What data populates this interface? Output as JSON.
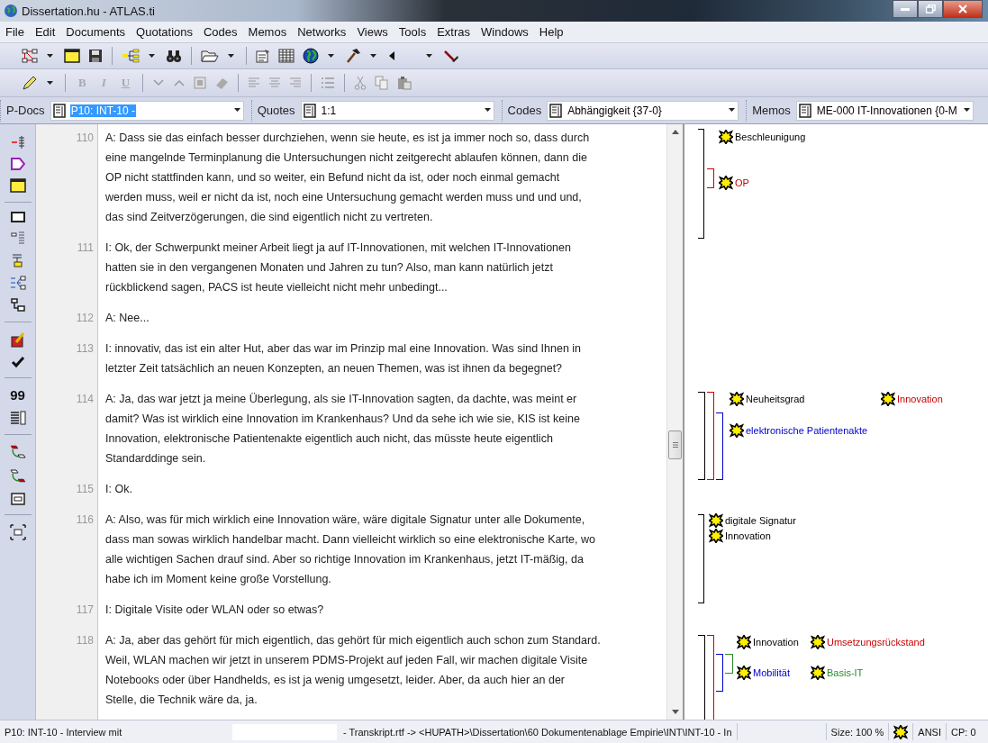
{
  "window": {
    "title": "Dissertation.hu - ATLAS.ti"
  },
  "menu": [
    "File",
    "Edit",
    "Documents",
    "Quotations",
    "Codes",
    "Memos",
    "Networks",
    "Views",
    "Tools",
    "Extras",
    "Windows",
    "Help"
  ],
  "format_buttons": [
    {
      "label": "B",
      "kind": "bold",
      "disabled": true
    },
    {
      "label": "I",
      "kind": "italic",
      "disabled": true
    },
    {
      "label": "U",
      "kind": "underline",
      "disabled": true
    }
  ],
  "side_toolbar": {
    "count_label": "99"
  },
  "selectors": [
    {
      "label": "P-Docs",
      "value": "P10: INT-10 -",
      "focused": true
    },
    {
      "label": "Quotes",
      "value": "1:1",
      "focused": false
    },
    {
      "label": "Codes",
      "value": "Abhängigkeit {37-0}",
      "focused": false
    },
    {
      "label": "Memos",
      "value": "ME-000 IT-Innovationen {0-M",
      "focused": false
    }
  ],
  "paragraphs": [
    {
      "number": "110",
      "lines": [
        "A: Dass sie das einfach besser durchziehen, wenn sie heute, es ist ja immer noch so, dass durch",
        "eine mangelnde Terminplanung die Untersuchungen nicht zeitgerecht ablaufen können, dann die",
        "OP nicht stattfinden kann, und so weiter, ein Befund nicht da ist, oder noch einmal gemacht",
        "werden muss, weil er nicht da ist, noch eine Untersuchung gemacht werden muss und und und,",
        "das sind Zeitverzögerungen, die sind eigentlich nicht zu vertreten."
      ]
    },
    {
      "number": "111",
      "lines": [
        "I: Ok, der Schwerpunkt meiner Arbeit liegt ja auf IT-Innovationen, mit welchen IT-Innovationen",
        "hatten sie in den vergangenen Monaten und Jahren zu tun? Also, man kann natürlich jetzt",
        "rückblickend sagen, PACS ist heute vielleicht nicht mehr unbedingt..."
      ]
    },
    {
      "number": "112",
      "lines": [
        "A: Nee..."
      ]
    },
    {
      "number": "113",
      "lines": [
        "I: innovativ, das ist ein alter Hut, aber das war im Prinzip mal eine Innovation. Was sind Ihnen in",
        "letzter Zeit tatsächlich an neuen Konzepten, an neuen Themen, was ist ihnen da begegnet?"
      ]
    },
    {
      "number": "114",
      "lines": [
        "A: Ja, das war jetzt ja meine Überlegung, als sie IT-Innovation sagten, da dachte, was meint er",
        "damit? Was ist wirklich eine Innovation im Krankenhaus? Und da sehe ich wie sie, KIS ist keine",
        "Innovation, elektronische Patientenakte eigentlich auch nicht, das müsste heute eigentlich",
        "Standarddinge sein."
      ]
    },
    {
      "number": "115",
      "lines": [
        "I: Ok."
      ]
    },
    {
      "number": "116",
      "lines": [
        "A: Also, was für mich wirklich eine Innovation wäre, wäre digitale Signatur unter alle Dokumente,",
        "dass man sowas wirklich handelbar macht. Dann vielleicht wirklich so eine elektronische Karte, wo",
        "alle wichtigen Sachen drauf sind. Aber so richtige Innovation im Krankenhaus, jetzt IT-mäßig, da",
        "habe ich im Moment keine große Vorstellung."
      ]
    },
    {
      "number": "117",
      "lines": [
        "I: Digitale Visite oder WLAN oder so etwas?"
      ]
    },
    {
      "number": "118",
      "lines": [
        "A: Ja, aber das gehört für mich eigentlich, das gehört für mich eigentlich auch schon zum Standard.",
        "Weil, WLAN machen wir jetzt in unserem PDMS-Projekt auf jeden Fall, wir machen digitale Visite",
        "Notebooks oder über Handhelds, es ist ja wenig umgesetzt, leider. Aber, da auch hier an der",
        "Stelle, die Technik wäre da, ja."
      ]
    }
  ],
  "margin": [
    {
      "brackets": [
        {
          "color": "#000000",
          "codes": [
            "Beschleunigung"
          ]
        },
        {
          "color": "#cc0000",
          "codes": [
            "OP"
          ]
        }
      ]
    },
    {
      "brackets": [
        {
          "color": "#000000",
          "codes": [
            "Neuheitsgrad"
          ]
        },
        {
          "color": "#cc0000",
          "codes": [
            "Innovation"
          ]
        },
        {
          "color": "#0000cc",
          "codes": [
            "elektronische Patientenakte"
          ]
        }
      ]
    },
    {
      "brackets": [
        {
          "color": "#000000",
          "codes": [
            "digitale Signatur",
            "Innovation"
          ]
        }
      ]
    },
    {
      "brackets": [
        {
          "color": "#000000",
          "codes": [
            "Innovation"
          ]
        },
        {
          "color": "#cc0000",
          "codes": [
            "Umsetzungsrückstand"
          ]
        },
        {
          "color": "#0000cc",
          "codes": [
            "Mobilität"
          ]
        },
        {
          "color": "#2a8a2a",
          "codes": [
            "Basis-IT"
          ]
        }
      ]
    }
  ],
  "status_bar": {
    "document": "P10: INT-10 - Interview mit",
    "path": "- Transkript.rtf -> <HUPATH>\\Dissertation\\60 Dokumentenablage Empirie\\INT\\INT-10 - In",
    "size": "Size: 100 %",
    "encoding": "ANSI",
    "codepage": "CP: 0"
  }
}
